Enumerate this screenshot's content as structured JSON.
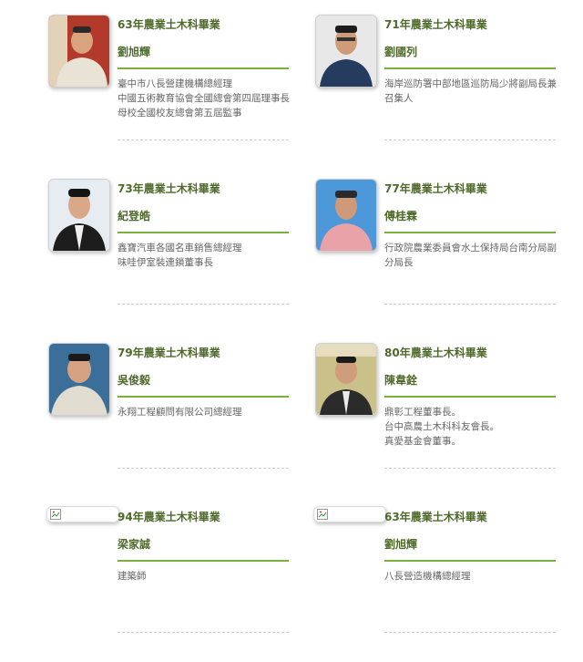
{
  "alumni": [
    {
      "year": "63年農業土木科畢業",
      "name": "劉旭輝",
      "lines": [
        "臺中市八長營建機構總經理",
        "中國五術教育協會全國總會第四屆理事長",
        "母校全國校友總會第五屆監事"
      ],
      "photo": "photo",
      "bg": "#b33a2a",
      "shirt": "#e9e3d5"
    },
    {
      "year": "71年農業土木科畢業",
      "name": "劉國列",
      "lines": [
        "海岸巡防署中部地區巡防局少將副局長兼召集人"
      ],
      "photo": "photo",
      "bg": "#e8e8e8",
      "shirt": "#253c5e"
    },
    {
      "year": "73年農業土木科畢業",
      "name": "紀登皓",
      "lines": [
        "鑫寶汽車各國名車銷售總經理",
        "味哇伊室裝連鎖董事長"
      ],
      "photo": "photo",
      "bg": "#e6ecf2",
      "shirt": "#1d1d1d"
    },
    {
      "year": "77年農業土木科畢業",
      "name": "傅桂霖",
      "lines": [
        "行政院農業委員會水土保持局台南分局副分局長"
      ],
      "photo": "photo",
      "bg": "#4c98d8",
      "shirt": "#e9a3a8"
    },
    {
      "year": "79年農業土木科畢業",
      "name": "吳俊毅",
      "lines": [
        "永翔工程顧問有限公司總經理"
      ],
      "photo": "photo",
      "bg": "#3b6e98",
      "shirt": "#e1dcd0"
    },
    {
      "year": "80年農業土木科畢業",
      "name": "陳韋銓",
      "lines": [
        "鼎彰工程董事長。",
        "台中高農土木科科友會長。",
        "真愛基金會董事。"
      ],
      "photo": "photo",
      "bg": "#c9c08a",
      "shirt": "#2b2b2b"
    },
    {
      "year": "94年農業土木科畢業",
      "name": "梁家誠",
      "lines": [
        "建築師"
      ],
      "photo": "broken"
    },
    {
      "year": "63年農業土木科畢業",
      "name": "劉旭輝",
      "lines": [
        "八長營造機構總經理"
      ],
      "photo": "broken"
    }
  ]
}
